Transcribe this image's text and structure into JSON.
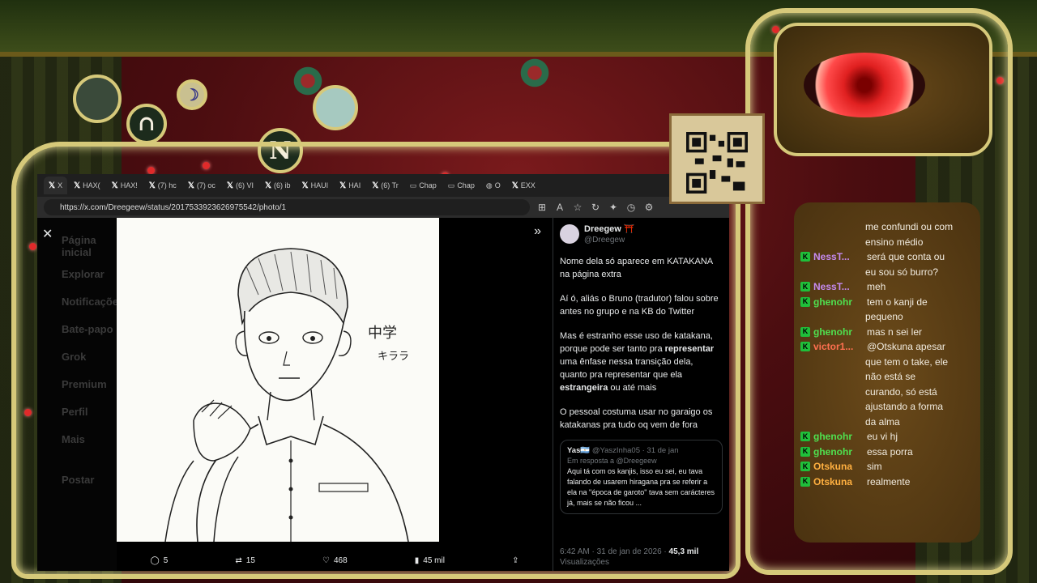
{
  "browser": {
    "tabs": [
      "X",
      "HAX(",
      "HAX!",
      "(7) hc",
      "(7) oc",
      "(6) VI",
      "(6) ib",
      "HAUI",
      "HAI",
      "(6) Tr",
      "Chap",
      "Chap",
      "O",
      "EXX"
    ],
    "url": "https://x.com/Dreegeew/status/2017533923626975542/photo/1",
    "sidebar_nav": [
      "Página inicial",
      "Explorar",
      "Notificações",
      "Bate-papo",
      "Grok",
      "Premium",
      "Perfil",
      "Mais"
    ],
    "post_button": "Postar"
  },
  "photo": {
    "caption_kanji": "中学",
    "caption_katakana": "キララ",
    "actions": {
      "replies": "5",
      "reposts": "15",
      "likes": "468",
      "views": "45 mil"
    }
  },
  "tweet": {
    "author_name": "Dreegew ⛩️",
    "author_handle": "@Dreegew",
    "paragraphs": [
      [
        "Nome dela só aparece em KATAKANA na página extra"
      ],
      [
        "Aí ó, aliás o Bruno (tradutor) falou sobre antes no grupo e na KB do Twitter"
      ],
      [
        "Mas é estranho esse uso de katakana, porque pode ser tanto pra "
      ],
      [
        "O pessoal costuma usar no garaigo os katakanas pra tudo oq vem de fora"
      ]
    ],
    "p3_bold1": "representar",
    "p3_mid": " uma ênfase nessa transição dela, quanto pra representar que ela ",
    "p3_bold2": "estrangeira",
    "p3_end": " ou até mais",
    "quote": {
      "name": "Yas🇦🇷",
      "handle": "@YaszInha05 · 31 de jan",
      "reply_to": "Em resposta a @Dreegeew",
      "text": "Aqui tá com os kanjis, isso eu sei, eu tava falando de usarem hiragana pra se referir a ela na \"época de garoto\" tava sem carácteres já, mais se não ficou ..."
    },
    "time": "6:42 AM · 31 de jan de 2026 · ",
    "views_count": "45,3 mil",
    "views_label": "Visualizações"
  },
  "chat": {
    "messages": [
      {
        "user": "",
        "text": "me confundi ou com",
        "color": "#f2ece0",
        "cont": true
      },
      {
        "user": "",
        "text": "ensino médio",
        "color": "#f2ece0",
        "cont": true
      },
      {
        "user": "NessT...",
        "text": "será que conta ou",
        "color": "#c58af0",
        "badge": true
      },
      {
        "user": "",
        "text": "eu sou só burro?",
        "color": "#f2ece0",
        "cont": true
      },
      {
        "user": "NessT...",
        "text": "meh",
        "color": "#c58af0",
        "badge": true
      },
      {
        "user": "ghenohr",
        "text": "tem o kanji de",
        "color": "#4fe04f",
        "badge": true
      },
      {
        "user": "",
        "text": "pequeno",
        "color": "#f2ece0",
        "cont": true
      },
      {
        "user": "ghenohr",
        "text": "mas n sei ler",
        "color": "#4fe04f",
        "badge": true
      },
      {
        "user": "victor1...",
        "text": "@Otskuna apesar",
        "color": "#ff7050",
        "badge": true
      },
      {
        "user": "",
        "text": "que tem o take, ele",
        "color": "#f2ece0",
        "cont": true
      },
      {
        "user": "",
        "text": "não está se",
        "color": "#f2ece0",
        "cont": true
      },
      {
        "user": "",
        "text": "curando, só está",
        "color": "#f2ece0",
        "cont": true
      },
      {
        "user": "",
        "text": "ajustando a forma",
        "color": "#f2ece0",
        "cont": true
      },
      {
        "user": "",
        "text": "da alma",
        "color": "#f2ece0",
        "cont": true
      },
      {
        "user": "ghenohr",
        "text": "eu vi hj",
        "color": "#4fe04f",
        "badge": true
      },
      {
        "user": "ghenohr",
        "text": "essa porra",
        "color": "#4fe04f",
        "badge": true
      },
      {
        "user": "Otskuna",
        "text": "sim",
        "color": "#ffb040",
        "badge": true
      },
      {
        "user": "Otskuna",
        "text": "realmente",
        "color": "#ffb040",
        "badge": true
      }
    ]
  },
  "overlay": {
    "medallion_n": "N"
  },
  "colors": {
    "gold": "#d6c97a",
    "x_bg": "#000000",
    "badge_green": "#1fbf3a"
  }
}
